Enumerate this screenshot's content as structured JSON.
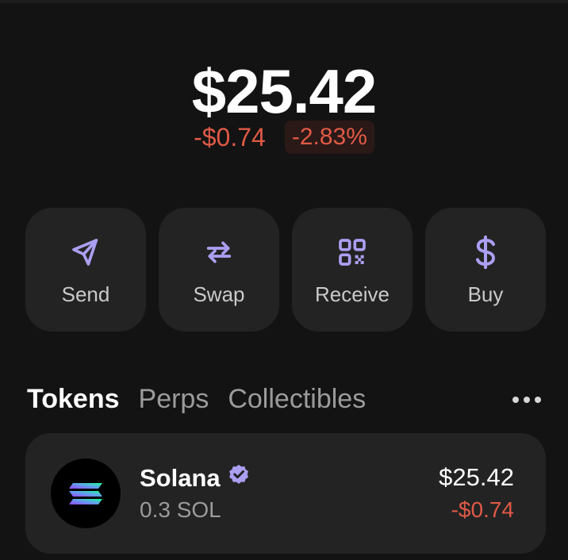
{
  "balance": {
    "total": "$25.42",
    "change_amount": "-$0.74",
    "change_percent": "-2.83%"
  },
  "actions": [
    {
      "label": "Send",
      "icon": "send-icon"
    },
    {
      "label": "Swap",
      "icon": "swap-icon"
    },
    {
      "label": "Receive",
      "icon": "qr-code-icon"
    },
    {
      "label": "Buy",
      "icon": "dollar-icon"
    }
  ],
  "tabs": [
    {
      "label": "Tokens",
      "active": true
    },
    {
      "label": "Perps",
      "active": false
    },
    {
      "label": "Collectibles",
      "active": false
    }
  ],
  "tokens": [
    {
      "name": "Solana",
      "verified": true,
      "amount": "0.3 SOL",
      "value": "$25.42",
      "change": "-$0.74"
    }
  ],
  "colors": {
    "background": "#131313",
    "card": "#232323",
    "accent": "#ab9ff2",
    "negative": "#e05a47"
  }
}
